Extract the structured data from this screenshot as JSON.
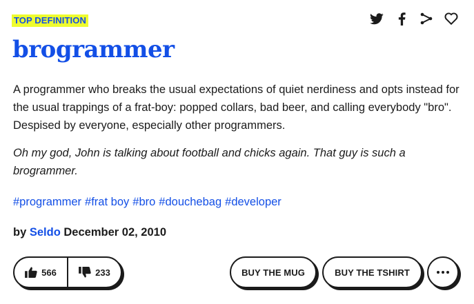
{
  "badge": {
    "label": "TOP DEFINITION"
  },
  "share": {
    "icons": [
      "twitter-icon",
      "facebook-icon",
      "share-icon",
      "heart-icon"
    ]
  },
  "entry": {
    "word": "brogrammer",
    "meaning": "A programmer who breaks the usual expectations of quiet nerdiness and opts instead for the usual trappings of a frat-boy: popped collars, bad beer, and calling everybody \"bro\". Despised by everyone, especially other programmers.",
    "example": "Oh my god, John is talking about football and chicks again. That guy is such a brogrammer.",
    "tags": [
      "#programmer",
      "#frat boy",
      "#bro",
      "#douchebag",
      "#developer"
    ],
    "by_label": "by",
    "author": "Seldo",
    "date": "December 02, 2010"
  },
  "votes": {
    "up": "566",
    "down": "233"
  },
  "actions": {
    "mug_label": "BUY THE MUG",
    "tshirt_label": "BUY THE TSHIRT"
  },
  "colors": {
    "accent": "#134fe6",
    "highlight": "#eefc2f",
    "text": "#1b1b1b"
  }
}
